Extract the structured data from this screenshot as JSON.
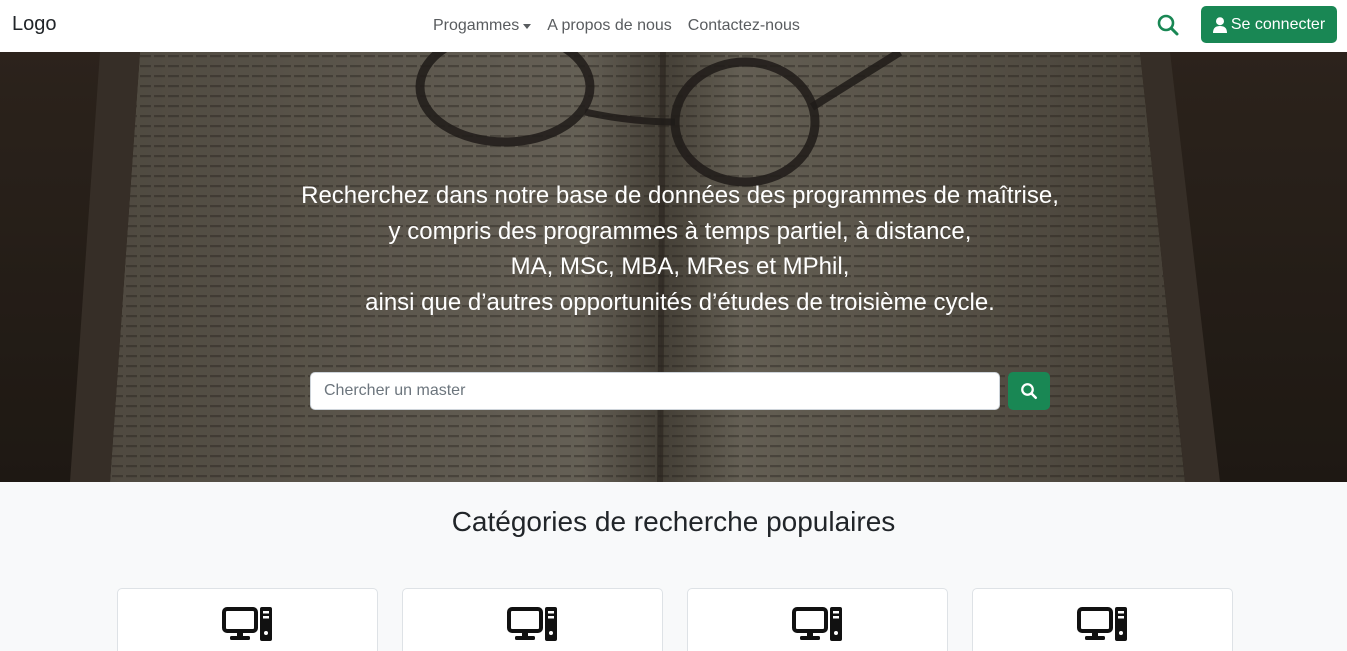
{
  "navbar": {
    "logo": "Logo",
    "links": [
      {
        "label": "Progammes",
        "has_dropdown": true
      },
      {
        "label": "A propos de nous"
      },
      {
        "label": "Contactez-nous"
      }
    ],
    "search_icon": "search-icon",
    "login_label": "Se connecter",
    "login_icon": "user-icon"
  },
  "hero": {
    "lines": [
      "Recherchez dans notre base de données des programmes de maîtrise,",
      "y compris des programmes à temps partiel, à distance,",
      "MA, MSc, MBA, MRes et MPhil,",
      "ainsi que d’autres opportunités d’études de troisième cycle."
    ],
    "search_placeholder": "Chercher un master",
    "search_value": "",
    "search_button_icon": "search-icon"
  },
  "categories": {
    "title": "Catégories de recherche populaires",
    "cards": [
      {
        "icon": "desktop-computer-icon"
      },
      {
        "icon": "desktop-computer-icon"
      },
      {
        "icon": "desktop-computer-icon"
      },
      {
        "icon": "desktop-computer-icon"
      }
    ]
  },
  "colors": {
    "primary": "#198754",
    "nav_text": "#595c5f",
    "text": "#212529",
    "page_bg": "#f8f9fa"
  }
}
